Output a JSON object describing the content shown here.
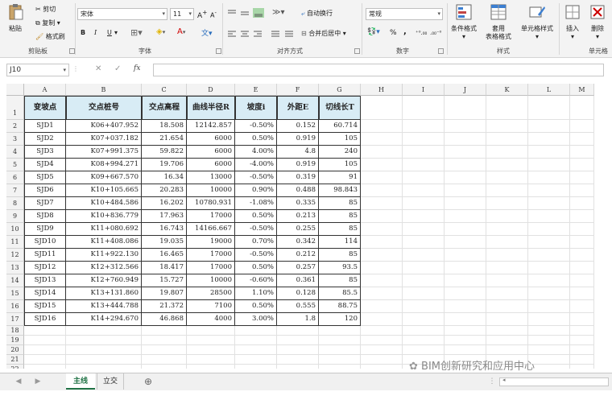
{
  "ribbon": {
    "clipboard": {
      "label": "剪贴板",
      "paste": "粘贴",
      "cut": "剪切",
      "copy": "复制",
      "format_painter": "格式刷"
    },
    "font": {
      "label": "字体",
      "font_name": "宋体",
      "font_size": "11",
      "bold": "B",
      "italic": "I",
      "underline": "U"
    },
    "alignment": {
      "label": "对齐方式",
      "wrap": "自动换行",
      "merge": "合并后居中"
    },
    "number": {
      "label": "数字",
      "format": "常规",
      "percent": "%",
      "comma": ","
    },
    "styles": {
      "label": "样式",
      "conditional": "条件格式",
      "table_l1": "套用",
      "table_l2": "表格格式",
      "cell_styles": "单元格样式"
    },
    "cells": {
      "label": "单元格",
      "insert": "插入",
      "delete": "删除"
    }
  },
  "formula_bar": {
    "name_box": "J10",
    "fx": "fx"
  },
  "columns": [
    "A",
    "B",
    "C",
    "D",
    "E",
    "F",
    "G",
    "H",
    "I",
    "J",
    "K",
    "L",
    "M"
  ],
  "rows": [
    "1",
    "2",
    "3",
    "4",
    "5",
    "6",
    "7",
    "8",
    "9",
    "10",
    "11",
    "12",
    "13",
    "14",
    "15",
    "16",
    "17",
    "18",
    "19",
    "20",
    "21",
    "22"
  ],
  "table": {
    "headers": [
      "变坡点",
      "交点桩号",
      "交点高程",
      "曲线半径R",
      "坡度i",
      "外距E",
      "切线长T"
    ],
    "data": [
      [
        "SJD1",
        "K06+407.952",
        "18.508",
        "12142.857",
        "-0.50%",
        "0.152",
        "60.714"
      ],
      [
        "SJD2",
        "K07+037.182",
        "21.654",
        "6000",
        "0.50%",
        "0.919",
        "105"
      ],
      [
        "SJD3",
        "K07+991.375",
        "59.822",
        "6000",
        "4.00%",
        "4.8",
        "240"
      ],
      [
        "SJD4",
        "K08+994.271",
        "19.706",
        "6000",
        "-4.00%",
        "0.919",
        "105"
      ],
      [
        "SJD5",
        "K09+667.570",
        "16.34",
        "13000",
        "-0.50%",
        "0.319",
        "91"
      ],
      [
        "SJD6",
        "K10+105.665",
        "20.283",
        "10000",
        "0.90%",
        "0.488",
        "98.843"
      ],
      [
        "SJD7",
        "K10+484.586",
        "16.202",
        "10780.931",
        "-1.08%",
        "0.335",
        "85"
      ],
      [
        "SJD8",
        "K10+836.779",
        "17.963",
        "17000",
        "0.50%",
        "0.213",
        "85"
      ],
      [
        "SJD9",
        "K11+080.692",
        "16.743",
        "14166.667",
        "-0.50%",
        "0.255",
        "85"
      ],
      [
        "SJD10",
        "K11+408.086",
        "19.035",
        "19000",
        "0.70%",
        "0.342",
        "114"
      ],
      [
        "SJD11",
        "K11+922.130",
        "16.465",
        "17000",
        "-0.50%",
        "0.212",
        "85"
      ],
      [
        "SJD12",
        "K12+312.566",
        "18.417",
        "17000",
        "0.50%",
        "0.257",
        "93.5"
      ],
      [
        "SJD13",
        "K12+760.949",
        "15.727",
        "10000",
        "-0.60%",
        "0.361",
        "85"
      ],
      [
        "SJD14",
        "K13+131.860",
        "19.807",
        "28500",
        "1.10%",
        "0.128",
        "85.5"
      ],
      [
        "SJD15",
        "K13+444.788",
        "21.372",
        "7100",
        "0.50%",
        "0.555",
        "88.75"
      ],
      [
        "SJD16",
        "K14+294.670",
        "46.868",
        "4000",
        "3.00%",
        "1.8",
        "120"
      ]
    ]
  },
  "sheet_tabs": [
    "主线",
    "立交"
  ],
  "watermark": "BIM创新研究和应用中心",
  "colors": {
    "header_fill": "#d8ecf5",
    "active_tab_text": "#217346"
  }
}
